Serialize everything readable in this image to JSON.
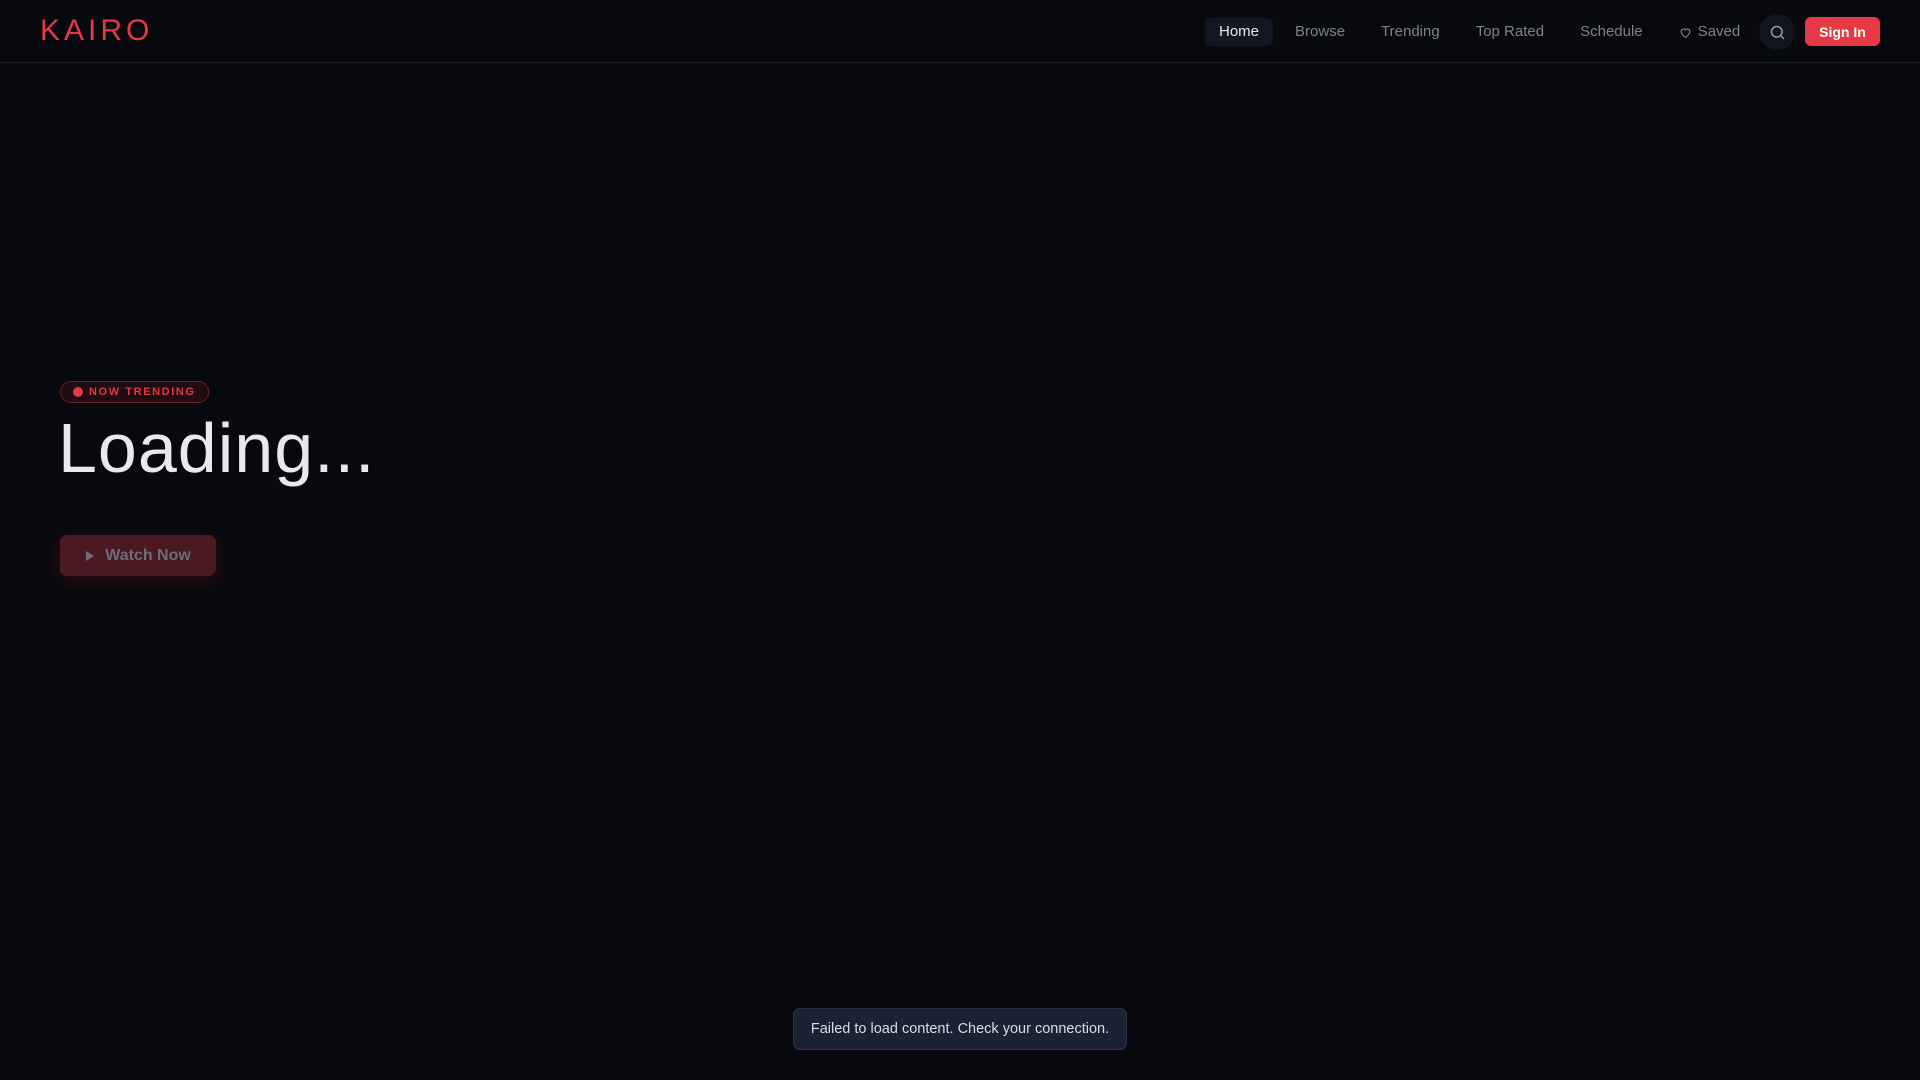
{
  "header": {
    "logo": "KAIRO",
    "nav": [
      {
        "label": "Home",
        "active": true
      },
      {
        "label": "Browse"
      },
      {
        "label": "Trending"
      },
      {
        "label": "Top Rated"
      },
      {
        "label": "Schedule"
      },
      {
        "label": "Saved",
        "icon": "heart-icon"
      }
    ],
    "search_icon": "search-icon",
    "signin_label": "Sign In"
  },
  "hero": {
    "badge": "NOW TRENDING",
    "title": "Loading...",
    "watch_label": "Watch Now",
    "watch_icon": "play-icon"
  },
  "toast": {
    "message": "Failed to load content. Check your connection."
  },
  "colors": {
    "accent": "#e63946",
    "background": "#07090e"
  }
}
